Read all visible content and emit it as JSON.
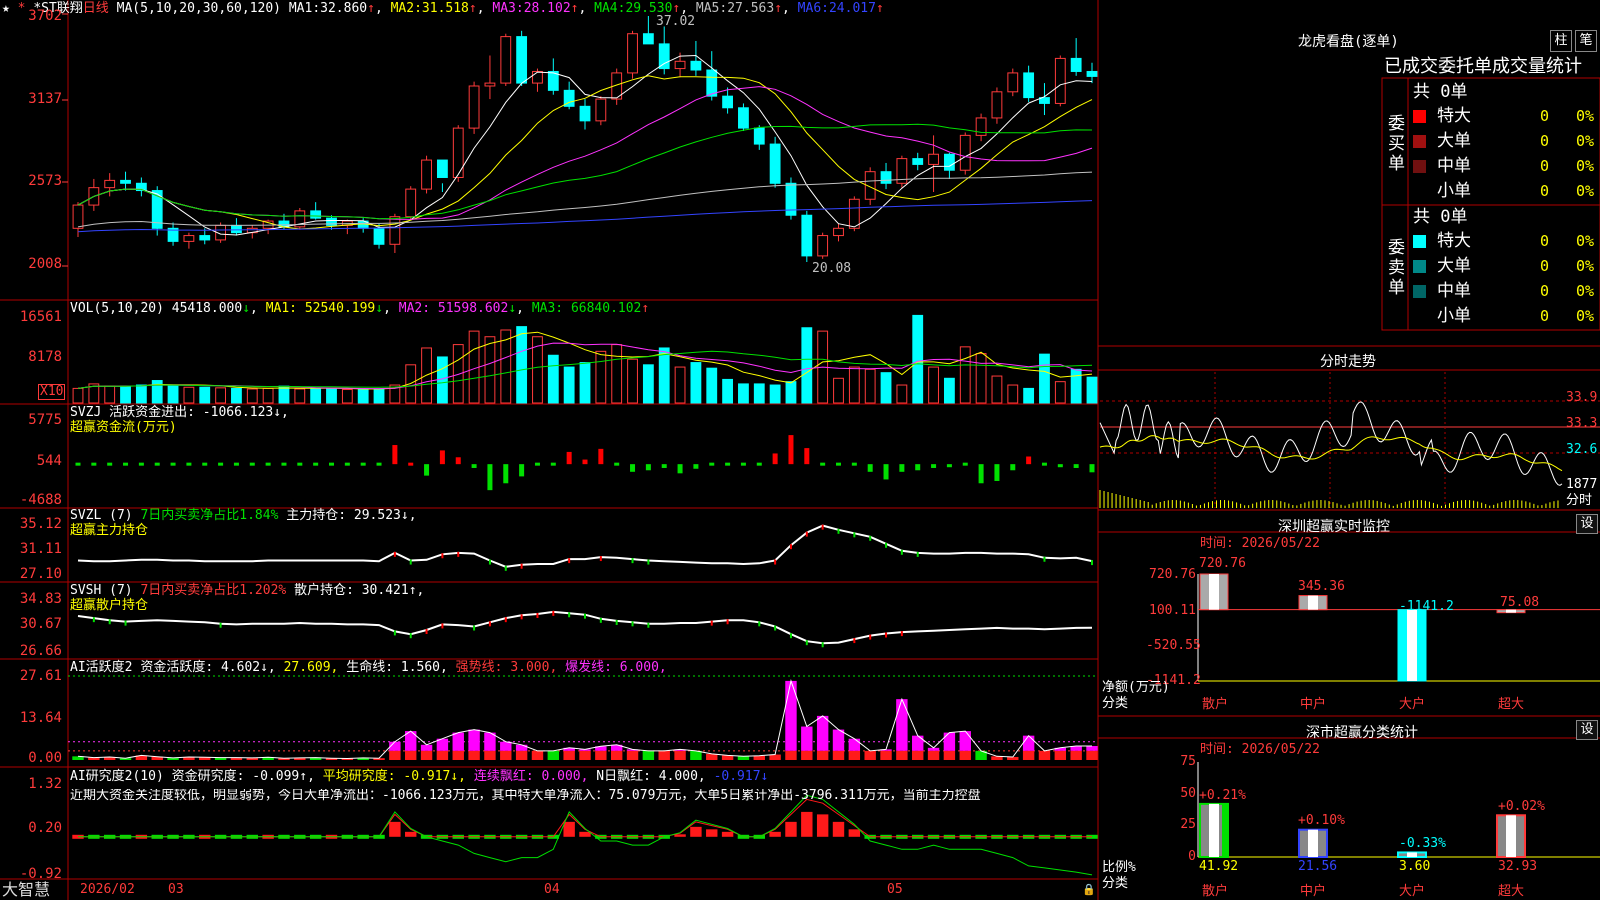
{
  "header": {
    "name": "*ST联翔",
    "period": "日线",
    "ma_label": "MA(5,10,20,30,60,120)",
    "ma": [
      {
        "label": "MA1:",
        "value": "32.860",
        "arrow": "↑"
      },
      {
        "label": "MA2:",
        "value": "31.518",
        "arrow": "↑"
      },
      {
        "label": "MA3:",
        "value": "28.102",
        "arrow": "↑"
      },
      {
        "label": "MA4:",
        "value": "29.530",
        "arrow": "↑"
      },
      {
        "label": "MA5:",
        "value": "27.563",
        "arrow": "↑"
      },
      {
        "label": "MA6:",
        "value": "24.017",
        "arrow": "↑"
      }
    ]
  },
  "price_axis": [
    "3702",
    "3137",
    "2573",
    "2008"
  ],
  "price_annotations": {
    "high": "37.02",
    "low": "20.08"
  },
  "vol": {
    "title": "VOL(5,10,20)",
    "value": "45418.000",
    "ma1": "MA1: 52540.199",
    "ma2": "MA2: 51598.602",
    "ma3": "MA3: 66840.102",
    "axis": [
      "16561",
      "8178"
    ],
    "unit": "X10"
  },
  "svzj": {
    "title": "SVZJ",
    "line": "活跃资金进出: -1066.123↓,",
    "sub": "超赢资金流(万元)",
    "axis": [
      "5775",
      "544",
      "-4688"
    ]
  },
  "svzl": {
    "title": "SVZL (7)",
    "ratio": "7日内买卖净占比1.84%",
    "hold": "主力持仓: 29.523↓,",
    "sub": "超赢主力持仓",
    "axis": [
      "35.12",
      "31.11",
      "27.10"
    ]
  },
  "svsh": {
    "title": "SVSH (7)",
    "ratio": "7日内买卖净占比1.202%",
    "hold": "散户持仓: 30.421↑,",
    "sub": "超赢散户持仓",
    "axis": [
      "34.83",
      "30.67",
      "26.66"
    ]
  },
  "ai_active": {
    "title": "AI活跃度2",
    "a": "资金活跃度: 4.602↓,",
    "b": "27.609,",
    "c": "生命线: 1.560,",
    "d": "强势线: 3.000,",
    "e": "爆发线: 6.000,",
    "axis": [
      "27.61",
      "13.64",
      "0.00"
    ]
  },
  "ai_research": {
    "title": "AI研究度2(10)",
    "a": "资金研究度: -0.099↑,",
    "b": "平均研究度: -0.917↓,",
    "c": "连续飘红: 0.000,",
    "d": "N日飘红: 4.000,",
    "e": "-0.917↓",
    "comment": "近期大资金关注度较低，明显弱势，今日大单净流出：-1066.123万元，其中特大单净流入：75.079万元，大单5日累计净出-3796.311万元，当前主力控盘",
    "axis": [
      "1.32",
      "0.20",
      "-0.92"
    ]
  },
  "date_axis": {
    "logo": "大智慧",
    "labels": [
      "2026/02",
      "03",
      "04",
      "05"
    ]
  },
  "dragon": {
    "title": "龙虎看盘(逐单)",
    "tabs": [
      "柱",
      "笔"
    ],
    "subtitle": "已成交委托单成交量统计",
    "buy_group": "委买单",
    "sell_group": "委卖单",
    "buy_total": "共 0单",
    "sell_total": "共 0单",
    "buy_rows": [
      {
        "name": "特大",
        "count": "0",
        "pct": "0%",
        "color": "#ff0000"
      },
      {
        "name": "大单",
        "count": "0",
        "pct": "0%",
        "color": "#a01010"
      },
      {
        "name": "中单",
        "count": "0",
        "pct": "0%",
        "color": "#701010"
      },
      {
        "name": "小单",
        "count": "0",
        "pct": "0%",
        "color": "#000000"
      }
    ],
    "sell_rows": [
      {
        "name": "特大",
        "count": "0",
        "pct": "0%",
        "color": "#00ffff"
      },
      {
        "name": "大单",
        "count": "0",
        "pct": "0%",
        "color": "#008888"
      },
      {
        "name": "中单",
        "count": "0",
        "pct": "0%",
        "color": "#006666"
      },
      {
        "name": "小单",
        "count": "0",
        "pct": "0%",
        "color": "#000000"
      }
    ]
  },
  "intraday": {
    "title": "分时走势",
    "axis": [
      "33.9",
      "33.3",
      "32.6"
    ],
    "vol_label": "1877",
    "vol_unit": "分时"
  },
  "monitor": {
    "title": "深圳超赢实时监控",
    "set": "设",
    "time": "时间: 2026/05/22",
    "axis": [
      "720.76",
      "100.11",
      "-520.55",
      "-1141.2"
    ],
    "ylabel": "净额(万元)",
    "xlabel": "分类",
    "categories": [
      "散户",
      "中户",
      "大户",
      "超大"
    ],
    "values_text": [
      "720.76",
      "345.36",
      "-1141.2",
      "75.08"
    ]
  },
  "classify": {
    "title": "深市超赢分类统计",
    "set": "设",
    "time": "时间: 2026/05/22",
    "axis": [
      "75",
      "50",
      "25",
      "0"
    ],
    "ylabel": "比例%",
    "xlabel": "分类",
    "categories": [
      "散户",
      "中户",
      "大户",
      "超大"
    ],
    "pct_labels": [
      "+0.21%",
      "+0.10%",
      "-0.33%",
      "+0.02%"
    ],
    "values_text": [
      "41.92",
      "21.56",
      "3.60",
      "32.93"
    ]
  },
  "chart_data": [
    {
      "type": "candlestick",
      "title": "*ST联翔 日线",
      "ylim": [
        20.08,
        37.02
      ],
      "candles": [
        [
          22.4,
          24.2,
          21.8,
          24.0
        ],
        [
          24.0,
          25.8,
          23.6,
          25.2
        ],
        [
          25.2,
          26.2,
          24.6,
          25.7
        ],
        [
          25.7,
          26.3,
          25.0,
          25.5
        ],
        [
          25.5,
          25.9,
          24.6,
          25.0
        ],
        [
          25.0,
          25.3,
          21.9,
          22.4
        ],
        [
          22.4,
          22.8,
          21.2,
          21.5
        ],
        [
          21.5,
          22.1,
          21.0,
          21.9
        ],
        [
          21.9,
          22.4,
          21.3,
          21.6
        ],
        [
          21.6,
          22.8,
          21.4,
          22.6
        ],
        [
          22.6,
          23.1,
          21.9,
          22.1
        ],
        [
          22.1,
          22.6,
          21.7,
          22.4
        ],
        [
          22.4,
          23.0,
          22.0,
          22.9
        ],
        [
          22.9,
          23.4,
          22.3,
          22.5
        ],
        [
          22.5,
          23.8,
          22.3,
          23.6
        ],
        [
          23.6,
          24.2,
          23.0,
          23.1
        ],
        [
          23.1,
          23.3,
          22.3,
          22.6
        ],
        [
          22.6,
          23.0,
          22.0,
          22.9
        ],
        [
          22.9,
          23.1,
          22.1,
          22.4
        ],
        [
          22.4,
          22.7,
          21.0,
          21.3
        ],
        [
          21.3,
          23.4,
          20.7,
          23.2
        ],
        [
          23.2,
          25.3,
          23.0,
          25.1
        ],
        [
          25.1,
          27.4,
          24.8,
          27.1
        ],
        [
          27.1,
          25.5,
          24.9,
          25.9
        ],
        [
          25.9,
          29.5,
          25.6,
          29.3
        ],
        [
          29.3,
          32.5,
          28.9,
          32.2
        ],
        [
          32.2,
          34.3,
          31.3,
          32.4
        ],
        [
          32.4,
          35.8,
          32.2,
          35.6
        ],
        [
          35.6,
          36.0,
          32.2,
          32.4
        ],
        [
          32.4,
          33.4,
          31.8,
          33.2
        ],
        [
          33.2,
          34.1,
          31.6,
          31.9
        ],
        [
          31.9,
          32.5,
          30.6,
          30.8
        ],
        [
          30.8,
          31.3,
          29.2,
          29.8
        ],
        [
          29.8,
          31.5,
          29.5,
          31.3
        ],
        [
          31.3,
          33.4,
          30.9,
          33.1
        ],
        [
          33.1,
          36.0,
          32.7,
          35.8
        ],
        [
          35.8,
          37.02,
          35.4,
          35.1
        ],
        [
          35.1,
          36.3,
          33.0,
          33.4
        ],
        [
          33.4,
          34.5,
          32.8,
          33.9
        ],
        [
          33.9,
          35.3,
          32.9,
          33.3
        ],
        [
          33.3,
          34.6,
          31.2,
          31.5
        ],
        [
          31.5,
          32.1,
          30.3,
          30.7
        ],
        [
          30.7,
          31.0,
          29.1,
          29.3
        ],
        [
          29.3,
          29.5,
          27.8,
          28.2
        ],
        [
          28.2,
          28.7,
          25.2,
          25.5
        ],
        [
          25.5,
          25.9,
          23.0,
          23.3
        ],
        [
          23.3,
          23.6,
          20.08,
          20.5
        ],
        [
          20.5,
          22.1,
          20.3,
          21.9
        ],
        [
          21.9,
          22.7,
          21.5,
          22.4
        ],
        [
          22.4,
          24.6,
          22.2,
          24.4
        ],
        [
          24.4,
          26.6,
          24.0,
          26.3
        ],
        [
          26.3,
          26.9,
          25.1,
          25.5
        ],
        [
          25.5,
          27.4,
          25.2,
          27.2
        ],
        [
          27.2,
          27.6,
          26.4,
          26.8
        ],
        [
          26.8,
          28.8,
          24.9,
          27.5
        ],
        [
          27.5,
          27.6,
          25.8,
          26.4
        ],
        [
          26.4,
          29.0,
          26.1,
          28.8
        ],
        [
          28.8,
          30.3,
          28.4,
          30.0
        ],
        [
          30.0,
          32.1,
          29.6,
          31.8
        ],
        [
          31.8,
          33.4,
          31.5,
          33.1
        ],
        [
          33.1,
          33.6,
          31.1,
          31.4
        ],
        [
          31.4,
          32.4,
          30.2,
          31.0
        ],
        [
          31.0,
          34.3,
          30.8,
          34.1
        ],
        [
          34.1,
          35.5,
          32.9,
          33.2
        ],
        [
          33.2,
          33.8,
          32.4,
          32.86
        ]
      ]
    },
    {
      "type": "bar",
      "title": "VOL(5,10,20)",
      "ylim": [
        0,
        16561
      ],
      "values": [
        2600,
        3400,
        3000,
        3000,
        3200,
        4000,
        3100,
        2800,
        2800,
        2700,
        2600,
        2500,
        2600,
        3000,
        2500,
        2600,
        2500,
        2400,
        2500,
        2500,
        3200,
        6800,
        9800,
        8200,
        10400,
        12800,
        11800,
        13000,
        13600,
        11800,
        8500,
        6400,
        7200,
        9200,
        10400,
        7800,
        6800,
        9800,
        6400,
        7200,
        6200,
        4200,
        3400,
        3400,
        3200,
        3800,
        13400,
        12800,
        4400,
        6400,
        6000,
        5400,
        3200,
        15600,
        6400,
        4400,
        10000,
        8800,
        4800,
        3200,
        2600,
        8700,
        3800,
        6000,
        4600
      ]
    },
    {
      "type": "bar",
      "title": "SVZJ 活跃资金进出",
      "ylim": [
        -4688,
        5775
      ],
      "values": [
        -150,
        -120,
        -100,
        -80,
        -200,
        -350,
        -300,
        -120,
        -100,
        -150,
        -130,
        -110,
        -200,
        -100,
        -130,
        -150,
        -120,
        -120,
        -110,
        -100,
        2500,
        180,
        -1500,
        1800,
        900,
        -500,
        -3400,
        -2500,
        -1600,
        -100,
        -200,
        1600,
        600,
        2000,
        -100,
        -1000,
        -800,
        -500,
        -1200,
        -600,
        -200,
        -150,
        -100,
        -200,
        1400,
        3800,
        2100,
        -200,
        -300,
        -300,
        -1000,
        -2000,
        -1000,
        -800,
        -500,
        -400,
        -200,
        -2500,
        -2200,
        -800,
        1000,
        -100,
        -400,
        -500,
        -1066
      ]
    },
    {
      "type": "line",
      "title": "SVZL 主力持仓",
      "ylim": [
        27.1,
        35.12
      ],
      "values": [
        29.6,
        29.5,
        29.5,
        29.6,
        29.7,
        29.7,
        29.6,
        29.6,
        29.5,
        29.5,
        29.5,
        29.5,
        29.6,
        29.6,
        29.6,
        29.6,
        29.6,
        29.6,
        29.6,
        29.5,
        30.7,
        29.6,
        29.7,
        30.5,
        30.7,
        30.6,
        29.6,
        28.7,
        29.0,
        29.1,
        29.1,
        29.8,
        29.8,
        30.1,
        30.0,
        29.8,
        29.6,
        29.5,
        29.4,
        29.3,
        29.2,
        29.2,
        29.1,
        29.2,
        29.6,
        31.8,
        33.6,
        34.6,
        34.0,
        33.5,
        33.0,
        32.0,
        31.0,
        30.7,
        30.6,
        30.6,
        30.7,
        30.7,
        30.6,
        30.6,
        30.5,
        30.0,
        29.9,
        30.0,
        29.523
      ]
    },
    {
      "type": "line",
      "title": "SVSH 散户持仓",
      "ylim": [
        26.66,
        34.83
      ],
      "values": [
        32.1,
        31.8,
        31.5,
        31.3,
        31.4,
        31.5,
        31.4,
        31.3,
        31.2,
        31.0,
        30.9,
        31.0,
        31.0,
        31.0,
        31.1,
        31.0,
        31.0,
        30.9,
        30.9,
        30.8,
        29.9,
        29.5,
        30.1,
        30.9,
        30.8,
        30.6,
        31.2,
        31.8,
        32.2,
        32.4,
        32.7,
        32.5,
        32.3,
        31.7,
        31.4,
        31.2,
        31.0,
        31.0,
        31.1,
        31.1,
        31.3,
        31.5,
        31.5,
        31.2,
        30.6,
        29.5,
        28.5,
        28.2,
        28.3,
        28.8,
        29.3,
        29.6,
        29.8,
        29.9,
        30.0,
        30.1,
        30.2,
        30.3,
        30.4,
        30.3,
        30.3,
        30.2,
        30.3,
        30.4,
        30.421
      ]
    },
    {
      "type": "bar",
      "title": "AI活跃度2",
      "ylim": [
        0,
        27.61
      ],
      "values": [
        1.2,
        0.8,
        1.0,
        0.6,
        1.5,
        1.1,
        0.7,
        1.0,
        0.9,
        0.8,
        0.8,
        0.7,
        0.9,
        0.6,
        0.7,
        0.8,
        0.6,
        0.5,
        0.7,
        0.6,
        6.0,
        9.5,
        5.0,
        7.0,
        9.0,
        10.0,
        9.0,
        6.0,
        5.0,
        3.0,
        3.0,
        4.0,
        3.5,
        4.5,
        5.0,
        3.5,
        3.0,
        3.0,
        3.5,
        3.0,
        2.0,
        1.5,
        1.2,
        1.4,
        1.8,
        26.0,
        11.0,
        14.5,
        10.0,
        7.0,
        3.0,
        3.5,
        20.0,
        8.0,
        4.0,
        9.0,
        9.5,
        3.0,
        1.2,
        1.0,
        8.0,
        3.0,
        4.0,
        4.6,
        4.602
      ]
    },
    {
      "type": "line",
      "title": "AI研究度2(10)",
      "ylim": [
        -0.92,
        1.32
      ],
      "values": [
        0.0,
        0.0,
        0.0,
        0.0,
        0.0,
        0.0,
        0.0,
        0.0,
        0.0,
        0.0,
        0.0,
        0.0,
        0.0,
        0.0,
        0.0,
        0.0,
        0.0,
        0.0,
        0.0,
        0.0,
        0.6,
        0.2,
        0.0,
        -0.1,
        -0.2,
        -0.4,
        -0.5,
        -0.6,
        -0.5,
        -0.5,
        -0.3,
        0.6,
        0.2,
        -0.1,
        -0.1,
        -0.2,
        -0.2,
        0.0,
        0.1,
        0.4,
        0.3,
        0.2,
        0.0,
        0.0,
        0.2,
        0.6,
        1.0,
        0.9,
        0.6,
        0.3,
        -0.1,
        -0.2,
        -0.3,
        -0.3,
        -0.2,
        -0.3,
        -0.3,
        -0.3,
        -0.4,
        -0.5,
        -0.7,
        -0.75,
        -0.8,
        -0.85,
        -0.917
      ]
    },
    {
      "type": "bar",
      "title": "深圳超赢实时监控",
      "categories": [
        "散户",
        "中户",
        "大户",
        "超大"
      ],
      "values": [
        720.76,
        345.36,
        -1141.2,
        75.08
      ],
      "ylim": [
        -1141.2,
        720.76
      ],
      "ylabel": "净额(万元)",
      "xlabel": "分类"
    },
    {
      "type": "bar",
      "title": "深市超赢分类统计",
      "categories": [
        "散户",
        "中户",
        "大户",
        "超大"
      ],
      "values": [
        41.92,
        21.56,
        3.6,
        32.93
      ],
      "ylim": [
        0,
        75
      ],
      "ylabel": "比例%",
      "xlabel": "分类"
    }
  ]
}
